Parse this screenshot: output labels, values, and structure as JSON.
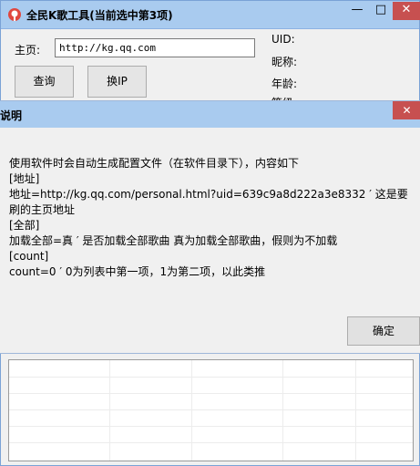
{
  "main_window": {
    "title": "全民K歌工具(当前选中第3项)",
    "buttons": {
      "minimize": "—",
      "maximize": "□",
      "close": "✕"
    },
    "home_label": "主页:",
    "url_value": "http://kg.qq.com",
    "query_button": "查询",
    "change_ip_button": "换IP",
    "info": {
      "uid": "UID:",
      "nickname": "昵称:",
      "age": "年龄:",
      "clipped": "等级:"
    }
  },
  "dialog": {
    "title": "说明",
    "close": "✕",
    "lines": [
      "使用软件时会自动生成配置文件（在软件目录下），内容如下",
      "[地址]",
      "地址=http://kg.qq.com/personal.html?uid=639c9a8d222a3e8332 ′ 这是要刷的主页地址",
      "[全部]",
      "加载全部=真 ′ 是否加载全部歌曲 真为加载全部歌曲，假则为不加载",
      "[count]",
      "count=0 ′ 0为列表中第一项，1为第二项，以此类推"
    ],
    "ok_button": "确定"
  }
}
